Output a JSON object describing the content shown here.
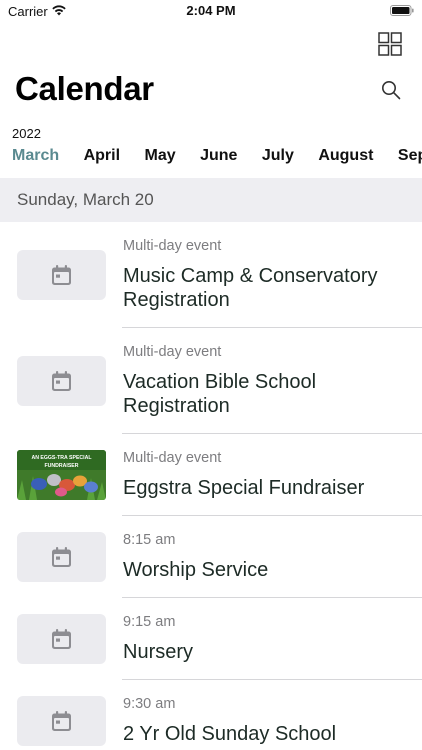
{
  "status_bar": {
    "carrier": "Carrier",
    "time": "2:04 PM"
  },
  "header": {
    "title": "Calendar",
    "year": "2022",
    "grid_icon": "grid-view-icon",
    "search_icon": "search-icon"
  },
  "months": [
    {
      "label": "March",
      "active": true
    },
    {
      "label": "April",
      "active": false
    },
    {
      "label": "May",
      "active": false
    },
    {
      "label": "June",
      "active": false
    },
    {
      "label": "July",
      "active": false
    },
    {
      "label": "August",
      "active": false
    },
    {
      "label": "Sep",
      "active": false
    }
  ],
  "date_section": {
    "label": "Sunday, March 20"
  },
  "events": [
    {
      "meta": "Multi-day event",
      "title": "Music Camp & Conservatory Registration",
      "thumb": "calendar-icon"
    },
    {
      "meta": "Multi-day event",
      "title": "Vacation Bible School Registration",
      "thumb": "calendar-icon"
    },
    {
      "meta": "Multi-day event",
      "title": "Eggstra Special Fundraiser",
      "thumb": "image",
      "thumb_caption_1": "AN EGGS-TRA SPECIAL",
      "thumb_caption_2": "FUNDRAISER"
    },
    {
      "meta": "8:15 am",
      "title": "Worship Service",
      "thumb": "calendar-icon"
    },
    {
      "meta": "9:15 am",
      "title": "Nursery",
      "thumb": "calendar-icon"
    },
    {
      "meta": "9:30 am",
      "title": "2 Yr Old Sunday School",
      "thumb": "calendar-icon"
    }
  ],
  "colors": {
    "accent": "#5a8a90",
    "section_bg": "#eeeef2",
    "thumb_bg": "#ebebef"
  }
}
